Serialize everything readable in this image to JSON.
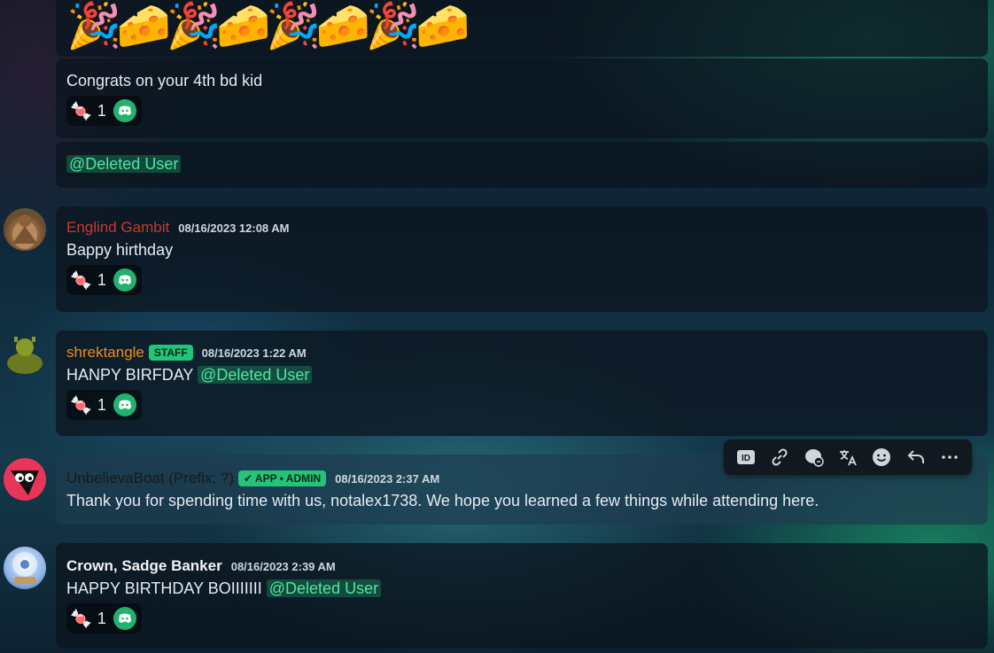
{
  "messages": [
    {
      "id": "emoji-message",
      "content": "🎉🧀🎉🧀🎉🧀🎉🧀"
    },
    {
      "id": "congrats",
      "text": "Congrats on your 4th bd kid",
      "reaction_count": "1"
    },
    {
      "id": "mention-only",
      "mention": "@Deleted User"
    },
    {
      "id": "englind",
      "author": "Englind Gambit",
      "author_color": "#c8382e",
      "timestamp": "08/16/2023 12:08 AM",
      "text": "Bappy hirthday",
      "reaction_count": "1"
    },
    {
      "id": "shrek",
      "author": "shrektangle",
      "author_color": "#f08a1c",
      "tag": "STAFF",
      "timestamp": "08/16/2023 1:22 AM",
      "text": "HANPY BIRFDAY",
      "mention": "@Deleted User",
      "reaction_count": "1"
    },
    {
      "id": "unbelieva",
      "author": "UnbelievaBoat (Prefix: ?)",
      "author_color": "#1a1a1a",
      "tag": "✔ APP • ADMIN",
      "timestamp": "08/16/2023 2:37 AM",
      "text": "Thank you for spending time with us, notalex1738. We hope you learned a few things while attending here."
    },
    {
      "id": "crown",
      "author": "Crown, Sadge Banker",
      "author_color": "#f2f3f5",
      "timestamp": "08/16/2023 2:39 AM",
      "text": "HAPPY BIRTHDAY BOIIIIIII",
      "mention": "@Deleted User",
      "reaction_count": "1"
    }
  ],
  "colors": {
    "accent_green": "#23c47a",
    "mention_text": "#4ee6a0",
    "card_bg": "#0c1620"
  },
  "toolbar": [
    "id-icon",
    "link-icon",
    "thread-icon",
    "translate-icon",
    "emoji-icon",
    "reply-icon",
    "more-icon"
  ]
}
